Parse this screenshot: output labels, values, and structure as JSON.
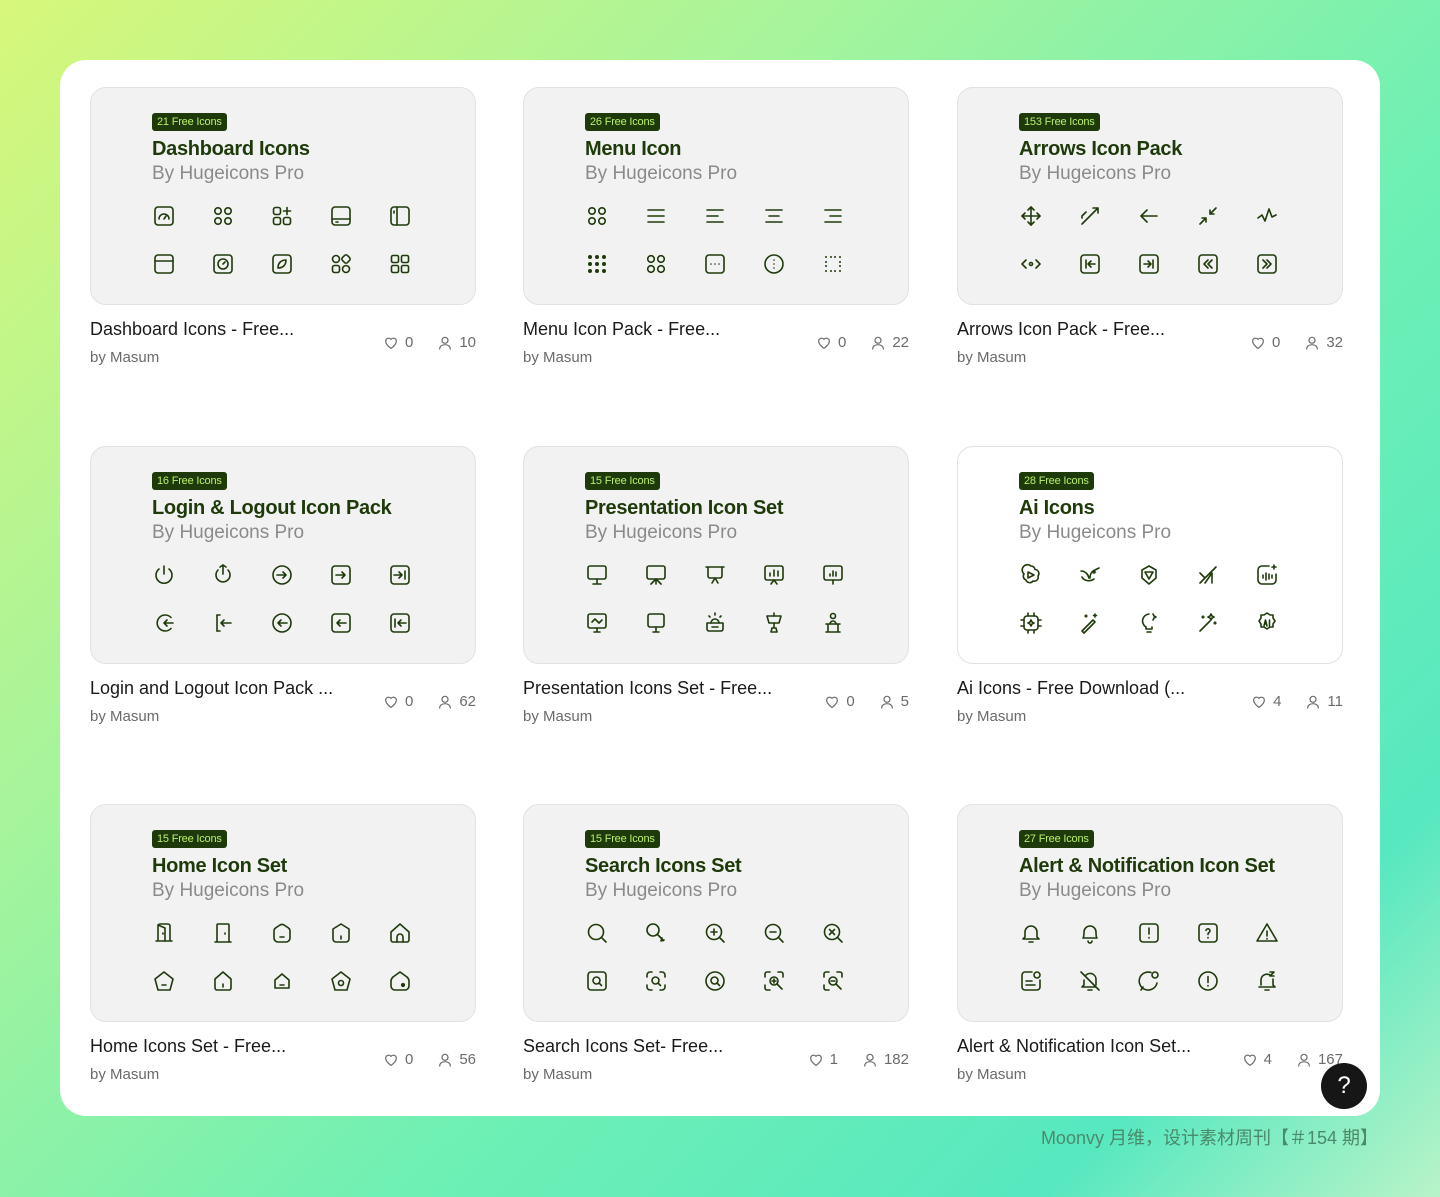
{
  "cards": [
    {
      "badge": "21 Free Icons",
      "title": "Dashboard Icons",
      "by": "By Hugeicons Pro",
      "caption": "Dashboard Icons - Free...",
      "author": "by Masum",
      "likes": "0",
      "users": "10",
      "white": false,
      "icons": [
        "dashboard-speed-icon",
        "grid-icon",
        "grid-add-icon",
        "layout-bottom-icon",
        "layout-left-icon",
        "browser-icon",
        "dashboard-circle-icon",
        "dashboard-square-icon",
        "grid-view-icon",
        "grid-view-alt-icon"
      ]
    },
    {
      "badge": "26 Free Icons",
      "title": "Menu Icon",
      "by": "By Hugeicons Pro",
      "caption": "Menu Icon Pack - Free...",
      "author": "by Masum",
      "likes": "0",
      "users": "22",
      "white": false,
      "icons": [
        "grid-icon",
        "menu-icon",
        "menu-left-icon",
        "menu-center-icon",
        "menu-right-icon",
        "dots-grid-icon",
        "circle-grid-icon",
        "menu-square-icon",
        "menu-circle-icon",
        "dots-small-grid-icon"
      ]
    },
    {
      "badge": "153 Free Icons",
      "title": "Arrows Icon Pack",
      "by": "By Hugeicons Pro",
      "caption": "Arrows Icon Pack - Free...",
      "author": "by Masum",
      "likes": "0",
      "users": "32",
      "white": false,
      "icons": [
        "move-icon",
        "arrow-data-transfer-icon",
        "arrow-left-icon",
        "arrow-shrink-icon",
        "arrow-zigzag-icon",
        "arrow-horizontal-icon",
        "arrow-left-square-icon",
        "arrow-right-square-icon",
        "arrow-double-left-icon",
        "arrow-double-right-icon"
      ]
    },
    {
      "badge": "16 Free Icons",
      "title": "Login & Logout Icon Pack",
      "by": "By Hugeicons Pro",
      "caption": "Login and Logout Icon Pack ...",
      "author": "by Masum",
      "likes": "0",
      "users": "62",
      "white": false,
      "icons": [
        "power-icon",
        "power-alt-icon",
        "login-circle-icon",
        "login-square-icon",
        "login-square-alt-icon",
        "logout-icon",
        "logout-alt-icon",
        "logout-circle-icon",
        "logout-square-icon",
        "logout-square-alt-icon"
      ]
    },
    {
      "badge": "15 Free Icons",
      "title": "Presentation Icon Set",
      "by": "By Hugeicons Pro",
      "caption": "Presentation Icons Set - Free...",
      "author": "by Masum",
      "likes": "0",
      "users": "5",
      "white": false,
      "icons": [
        "presentation-icon",
        "presentation-alt-icon",
        "presentation-board-icon",
        "presentation-chart-icon",
        "presentation-bar-icon",
        "presentation-line-icon",
        "presentation-stand-icon",
        "presentation-online-icon",
        "presentation-podium-icon",
        "presentation-speaker-icon"
      ]
    },
    {
      "badge": "28 Free Icons",
      "title": "Ai Icons",
      "by": "By Hugeicons Pro",
      "caption": "Ai Icons - Free Download (...",
      "author": "by Masum",
      "likes": "4",
      "users": "11",
      "white": true,
      "icons": [
        "chatgpt-icon",
        "ai-bird-icon",
        "ai-brain-icon",
        "grok-icon",
        "ai-voice-icon",
        "ai-chip-icon",
        "ai-magic-icon",
        "ai-idea-icon",
        "ai-sparkle-wand-icon",
        "ai-badge-icon"
      ]
    },
    {
      "badge": "15 Free Icons",
      "title": "Home Icon Set",
      "by": "By Hugeicons Pro",
      "caption": "Home Icons Set - Free...",
      "author": "by Masum",
      "likes": "0",
      "users": "56",
      "white": false,
      "icons": [
        "door-icon",
        "door-alt-icon",
        "home-rounded-icon",
        "home-hexagon-icon",
        "home-icon",
        "home-pentagon-icon",
        "home-outline-icon",
        "home-small-icon",
        "home-settings-icon",
        "home-dot-icon"
      ]
    },
    {
      "badge": "15 Free Icons",
      "title": "Search Icons Set",
      "by": "By Hugeicons Pro",
      "caption": "Search Icons Set- Free...",
      "author": "by Masum",
      "likes": "1",
      "users": "182",
      "white": false,
      "icons": [
        "search-icon",
        "search-alt-icon",
        "zoom-in-icon",
        "zoom-out-icon",
        "search-remove-icon",
        "search-square-icon",
        "search-focus-icon",
        "search-circle-icon",
        "zoom-in-frame-icon",
        "search-frame-icon"
      ]
    },
    {
      "badge": "27 Free Icons",
      "title": "Alert & Notification Icon Set",
      "by": "By Hugeicons Pro",
      "caption": "Alert & Notification Icon Set...",
      "author": "by Masum",
      "likes": "4",
      "users": "167",
      "white": false,
      "icons": [
        "bell-icon",
        "bell-alt-icon",
        "alert-square-icon",
        "help-square-icon",
        "alert-triangle-icon",
        "notification-square-icon",
        "bell-off-icon",
        "message-notification-icon",
        "alert-diamond-icon",
        "bell-sleep-icon"
      ]
    }
  ],
  "help_button": "?",
  "watermark": "Moonvy 月维，设计素材周刊【＃154 期】",
  "colors": {
    "badge_bg": "#1e3a0a",
    "badge_text": "#b9f06a",
    "title": "#1e3a0a",
    "icon_stroke": "#1e3a0a"
  }
}
